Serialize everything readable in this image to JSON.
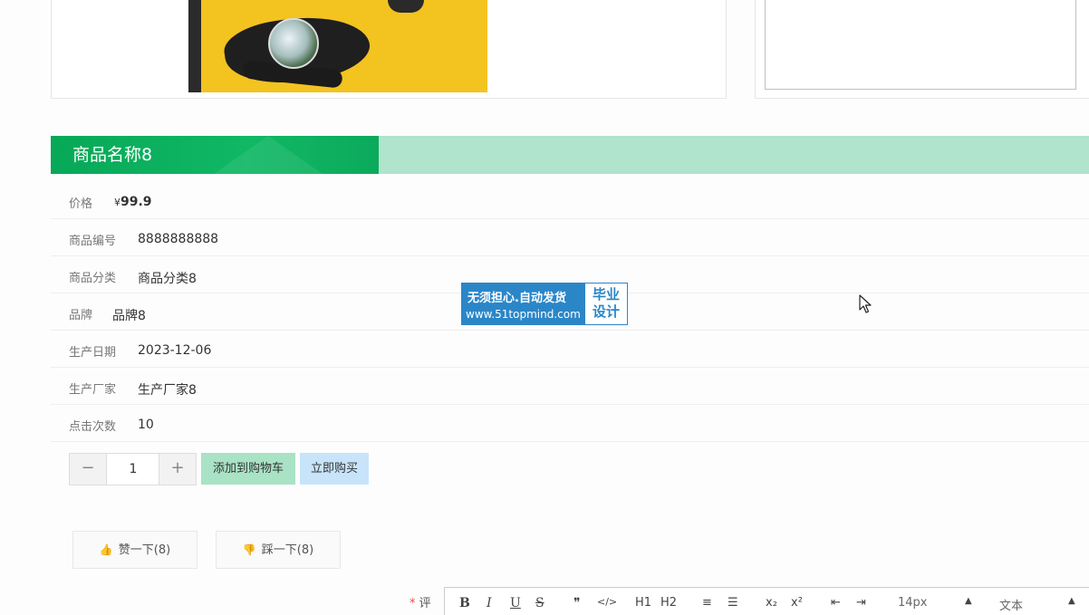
{
  "product": {
    "title": "商品名称8",
    "price_label": "价格",
    "price_currency": "¥",
    "price_value": "99.9",
    "fields": [
      {
        "label": "商品编号",
        "value": "8888888888"
      },
      {
        "label": "商品分类",
        "value": "商品分类8"
      },
      {
        "label": "品牌",
        "value": "品牌8"
      },
      {
        "label": "生产日期",
        "value": "2023-12-06"
      },
      {
        "label": "生产厂家",
        "value": "生产厂家8"
      },
      {
        "label": "点击次数",
        "value": "10"
      }
    ]
  },
  "watermark": {
    "line1": "无须担心.自动发货",
    "line2": "www.51topmind.com",
    "right_top": "毕业",
    "right_bottom": "设计"
  },
  "purchase": {
    "minus": "−",
    "quantity": "1",
    "plus": "+",
    "add_to_cart": "添加到购物车",
    "buy_now": "立即购买"
  },
  "votes": {
    "like": "赞一下(8)",
    "dislike": "踩一下(8)"
  },
  "comment": {
    "required_mark": "*",
    "label": "评",
    "toolbar": [
      "B",
      "I",
      "U",
      "S",
      "❞",
      "</>",
      "H1",
      "H2",
      "≡",
      "☰",
      "x₂",
      "x²",
      "⇤",
      "⇥"
    ],
    "font_size": "14px",
    "block_type": "文本"
  },
  "colors": {
    "title_green": "#07a858",
    "title_bar_light": "#b0e4cc",
    "cart_button": "#a9e2c5",
    "buy_button": "#c7e4fb",
    "watermark_blue": "#2b86c8"
  }
}
